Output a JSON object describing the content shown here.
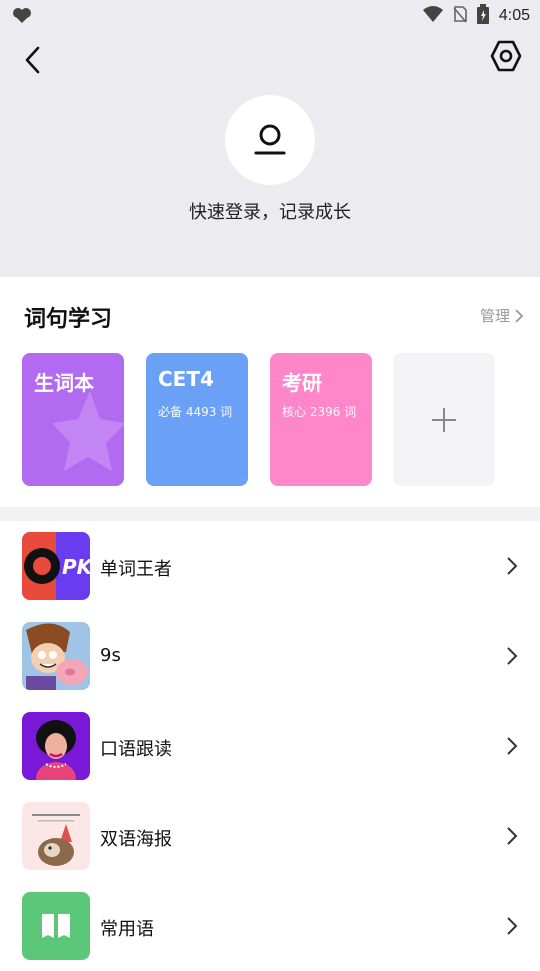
{
  "status_bar": {
    "time": "4:05",
    "icons": [
      "heart-icon",
      "wifi-icon",
      "no-sim-icon",
      "battery-icon"
    ]
  },
  "header": {
    "back_icon": "chevron-left-icon",
    "settings_icon": "hexagon-gear-icon",
    "avatar_icon": "user-icon",
    "login_text": "快速登录，记录成长"
  },
  "study_section": {
    "title": "词句学习",
    "manage_label": "管理",
    "cards": [
      {
        "title": "生词本",
        "subtitle": "",
        "color": "#b16af0"
      },
      {
        "title": "CET4",
        "subtitle": "必备 4493 词",
        "color": "#6aa0f6"
      },
      {
        "title": "考研",
        "subtitle": "核心 2396 词",
        "color": "#ff86c8"
      },
      {
        "title": "",
        "subtitle": "",
        "icon": "plus-icon",
        "color": "#f4f4f6"
      }
    ]
  },
  "list": [
    {
      "label": "单词王者"
    },
    {
      "label": "9s"
    },
    {
      "label": "口语跟读"
    },
    {
      "label": "双语海报"
    },
    {
      "label": "常用语"
    }
  ],
  "colors": {
    "header_bg": "#ebebf0",
    "list_chevron": "#333333",
    "muted_text": "#999999"
  }
}
